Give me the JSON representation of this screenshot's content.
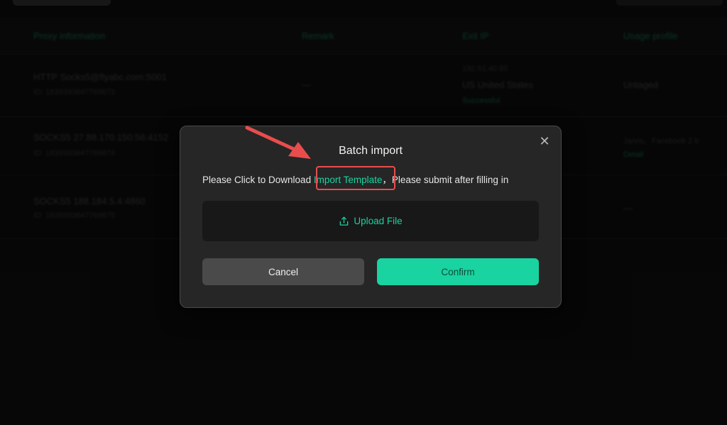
{
  "background": {
    "table_headers": [
      "Proxy information",
      "Remark",
      "Exit IP",
      "Usage profile"
    ],
    "rows": [
      {
        "proxy": "HTTP Socks5@flyabc.com:5001",
        "proxy_sub": "ID: 1839393847769873",
        "remark": "—",
        "exit_ip_line1": "192.51.40.85",
        "exit_ip_line2": "US United States",
        "exit_ip_line3": "Successful",
        "usage": "Untaged"
      },
      {
        "proxy": "SOCKS5 27.88.170.150:56:4152",
        "proxy_sub": "ID: 1839393847769874",
        "remark": "",
        "exit_ip_line1": "",
        "exit_ip_line2": "",
        "exit_ip_line3": "",
        "usage": "Jarvis、Facebook 2 b",
        "usage_sub": "Detail"
      },
      {
        "proxy": "SOCKS5 188.184.5.4:4860",
        "proxy_sub": "ID: 1839393847769875",
        "remark": "",
        "exit_ip_line1": "",
        "exit_ip_line2": "",
        "exit_ip_line3": "",
        "usage": "—"
      }
    ]
  },
  "modal": {
    "title": "Batch import",
    "desc_prefix": "Please Click to Download ",
    "desc_link": "Import Template",
    "desc_suffix": "，Please submit after filling in",
    "upload_label": "Upload File",
    "cancel_label": "Cancel",
    "confirm_label": "Confirm",
    "close_icon": "close-icon"
  },
  "colors": {
    "accent": "#19d3a0",
    "modal_bg": "#262626",
    "highlight": "#e84d4d"
  }
}
